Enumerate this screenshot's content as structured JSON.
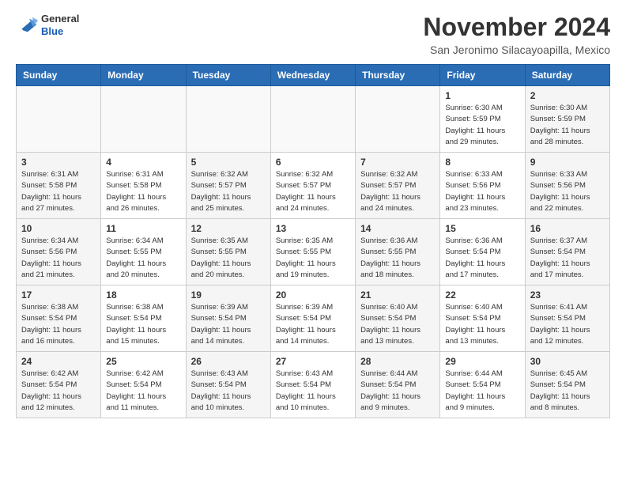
{
  "header": {
    "logo": {
      "line1": "General",
      "line2": "Blue"
    },
    "title": "November 2024",
    "location": "San Jeronimo Silacayoapilla, Mexico"
  },
  "calendar": {
    "days_of_week": [
      "Sunday",
      "Monday",
      "Tuesday",
      "Wednesday",
      "Thursday",
      "Friday",
      "Saturday"
    ],
    "weeks": [
      [
        {
          "day": "",
          "info": ""
        },
        {
          "day": "",
          "info": ""
        },
        {
          "day": "",
          "info": ""
        },
        {
          "day": "",
          "info": ""
        },
        {
          "day": "",
          "info": ""
        },
        {
          "day": "1",
          "info": "Sunrise: 6:30 AM\nSunset: 5:59 PM\nDaylight: 11 hours and 29 minutes."
        },
        {
          "day": "2",
          "info": "Sunrise: 6:30 AM\nSunset: 5:59 PM\nDaylight: 11 hours and 28 minutes."
        }
      ],
      [
        {
          "day": "3",
          "info": "Sunrise: 6:31 AM\nSunset: 5:58 PM\nDaylight: 11 hours and 27 minutes."
        },
        {
          "day": "4",
          "info": "Sunrise: 6:31 AM\nSunset: 5:58 PM\nDaylight: 11 hours and 26 minutes."
        },
        {
          "day": "5",
          "info": "Sunrise: 6:32 AM\nSunset: 5:57 PM\nDaylight: 11 hours and 25 minutes."
        },
        {
          "day": "6",
          "info": "Sunrise: 6:32 AM\nSunset: 5:57 PM\nDaylight: 11 hours and 24 minutes."
        },
        {
          "day": "7",
          "info": "Sunrise: 6:32 AM\nSunset: 5:57 PM\nDaylight: 11 hours and 24 minutes."
        },
        {
          "day": "8",
          "info": "Sunrise: 6:33 AM\nSunset: 5:56 PM\nDaylight: 11 hours and 23 minutes."
        },
        {
          "day": "9",
          "info": "Sunrise: 6:33 AM\nSunset: 5:56 PM\nDaylight: 11 hours and 22 minutes."
        }
      ],
      [
        {
          "day": "10",
          "info": "Sunrise: 6:34 AM\nSunset: 5:56 PM\nDaylight: 11 hours and 21 minutes."
        },
        {
          "day": "11",
          "info": "Sunrise: 6:34 AM\nSunset: 5:55 PM\nDaylight: 11 hours and 20 minutes."
        },
        {
          "day": "12",
          "info": "Sunrise: 6:35 AM\nSunset: 5:55 PM\nDaylight: 11 hours and 20 minutes."
        },
        {
          "day": "13",
          "info": "Sunrise: 6:35 AM\nSunset: 5:55 PM\nDaylight: 11 hours and 19 minutes."
        },
        {
          "day": "14",
          "info": "Sunrise: 6:36 AM\nSunset: 5:55 PM\nDaylight: 11 hours and 18 minutes."
        },
        {
          "day": "15",
          "info": "Sunrise: 6:36 AM\nSunset: 5:54 PM\nDaylight: 11 hours and 17 minutes."
        },
        {
          "day": "16",
          "info": "Sunrise: 6:37 AM\nSunset: 5:54 PM\nDaylight: 11 hours and 17 minutes."
        }
      ],
      [
        {
          "day": "17",
          "info": "Sunrise: 6:38 AM\nSunset: 5:54 PM\nDaylight: 11 hours and 16 minutes."
        },
        {
          "day": "18",
          "info": "Sunrise: 6:38 AM\nSunset: 5:54 PM\nDaylight: 11 hours and 15 minutes."
        },
        {
          "day": "19",
          "info": "Sunrise: 6:39 AM\nSunset: 5:54 PM\nDaylight: 11 hours and 14 minutes."
        },
        {
          "day": "20",
          "info": "Sunrise: 6:39 AM\nSunset: 5:54 PM\nDaylight: 11 hours and 14 minutes."
        },
        {
          "day": "21",
          "info": "Sunrise: 6:40 AM\nSunset: 5:54 PM\nDaylight: 11 hours and 13 minutes."
        },
        {
          "day": "22",
          "info": "Sunrise: 6:40 AM\nSunset: 5:54 PM\nDaylight: 11 hours and 13 minutes."
        },
        {
          "day": "23",
          "info": "Sunrise: 6:41 AM\nSunset: 5:54 PM\nDaylight: 11 hours and 12 minutes."
        }
      ],
      [
        {
          "day": "24",
          "info": "Sunrise: 6:42 AM\nSunset: 5:54 PM\nDaylight: 11 hours and 12 minutes."
        },
        {
          "day": "25",
          "info": "Sunrise: 6:42 AM\nSunset: 5:54 PM\nDaylight: 11 hours and 11 minutes."
        },
        {
          "day": "26",
          "info": "Sunrise: 6:43 AM\nSunset: 5:54 PM\nDaylight: 11 hours and 10 minutes."
        },
        {
          "day": "27",
          "info": "Sunrise: 6:43 AM\nSunset: 5:54 PM\nDaylight: 11 hours and 10 minutes."
        },
        {
          "day": "28",
          "info": "Sunrise: 6:44 AM\nSunset: 5:54 PM\nDaylight: 11 hours and 9 minutes."
        },
        {
          "day": "29",
          "info": "Sunrise: 6:44 AM\nSunset: 5:54 PM\nDaylight: 11 hours and 9 minutes."
        },
        {
          "day": "30",
          "info": "Sunrise: 6:45 AM\nSunset: 5:54 PM\nDaylight: 11 hours and 8 minutes."
        }
      ]
    ]
  }
}
